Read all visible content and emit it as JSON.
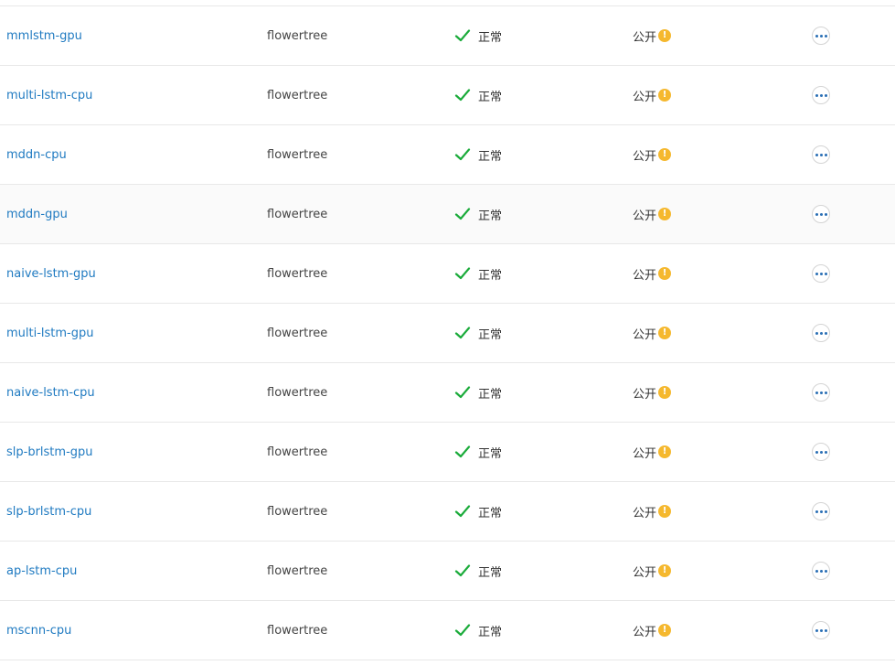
{
  "colors": {
    "link": "#1f7ac1",
    "success": "#1aab3a",
    "warning": "#f5b82e",
    "action": "#2a6fb5",
    "divider": "#e8e8e8",
    "hover_row": "#fafafa"
  },
  "icons": {
    "status": "check-icon",
    "visibility_hint": "warning-icon",
    "action": "more-icon"
  },
  "rows": [
    {
      "name": "mmlstm-gpu",
      "owner": "flowertree",
      "status": "正常",
      "visibility": "公开",
      "hint": "!"
    },
    {
      "name": "multi-lstm-cpu",
      "owner": "flowertree",
      "status": "正常",
      "visibility": "公开",
      "hint": "!"
    },
    {
      "name": "mddn-cpu",
      "owner": "flowertree",
      "status": "正常",
      "visibility": "公开",
      "hint": "!"
    },
    {
      "name": "mddn-gpu",
      "owner": "flowertree",
      "status": "正常",
      "visibility": "公开",
      "hint": "!"
    },
    {
      "name": "naive-lstm-gpu",
      "owner": "flowertree",
      "status": "正常",
      "visibility": "公开",
      "hint": "!"
    },
    {
      "name": "multi-lstm-gpu",
      "owner": "flowertree",
      "status": "正常",
      "visibility": "公开",
      "hint": "!"
    },
    {
      "name": "naive-lstm-cpu",
      "owner": "flowertree",
      "status": "正常",
      "visibility": "公开",
      "hint": "!"
    },
    {
      "name": "slp-brlstm-gpu",
      "owner": "flowertree",
      "status": "正常",
      "visibility": "公开",
      "hint": "!"
    },
    {
      "name": "slp-brlstm-cpu",
      "owner": "flowertree",
      "status": "正常",
      "visibility": "公开",
      "hint": "!"
    },
    {
      "name": "ap-lstm-cpu",
      "owner": "flowertree",
      "status": "正常",
      "visibility": "公开",
      "hint": "!"
    },
    {
      "name": "mscnn-cpu",
      "owner": "flowertree",
      "status": "正常",
      "visibility": "公开",
      "hint": "!"
    }
  ]
}
